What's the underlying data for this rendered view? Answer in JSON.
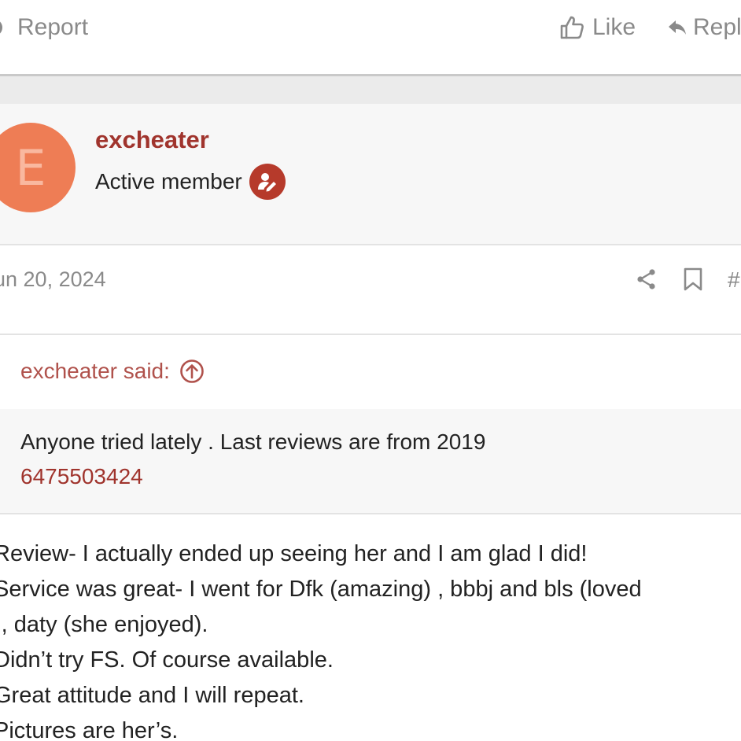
{
  "actions": {
    "report_label": "Report",
    "like_label": "Like",
    "reply_label": "Repl"
  },
  "user": {
    "avatar_letter": "E",
    "username": "excheater",
    "title": "Active member",
    "badge_icon": "user-edit-icon"
  },
  "post_meta": {
    "date": "un 20, 2024",
    "permalink": "#",
    "icons": [
      "share-icon",
      "bookmark-icon"
    ]
  },
  "quote": {
    "author": "excheater said:",
    "text": "Anyone tried lately . Last reviews are from 2019",
    "phone": "6475503424"
  },
  "post": {
    "lines": [
      "Review- I actually ended up seeing her and I am glad I did!",
      "Service was great- I went for Dfk (amazing) , bbbj and bls (loved",
      "), daty (she enjoyed).",
      "Didn’t try FS. Of course available.",
      "Great attitude and I will repeat.",
      "Pictures are her’s."
    ]
  },
  "colors": {
    "accent": "#a0342d",
    "avatar_bg": "#ee7d55",
    "badge_bg": "#b63a2b",
    "muted_text": "#8a8a8a"
  }
}
